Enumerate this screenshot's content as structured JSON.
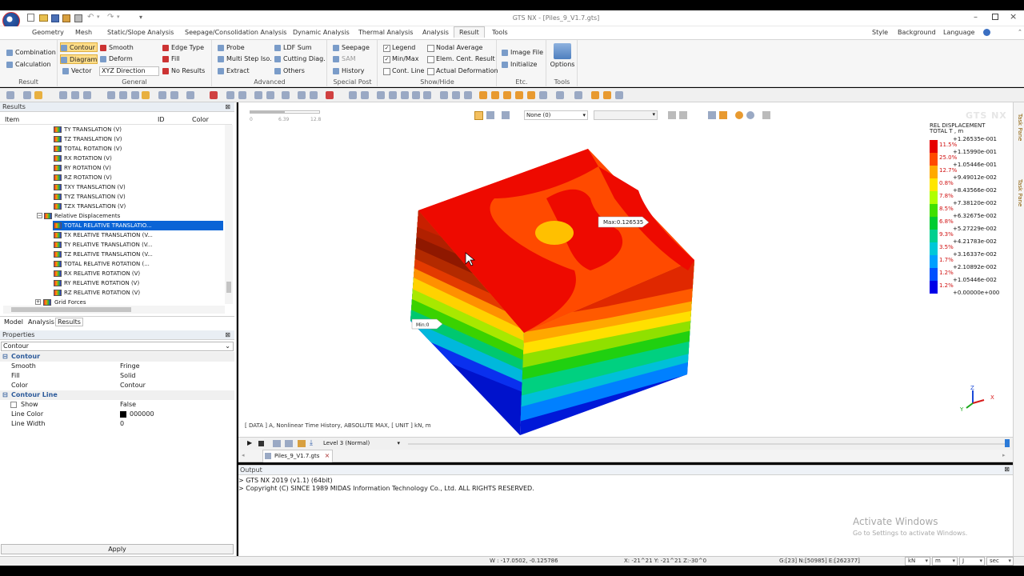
{
  "window": {
    "title": "GTS NX - [Piles_9_V1.7.gts]"
  },
  "menu": {
    "tabs": [
      "Geometry",
      "Mesh",
      "Static/Slope Analysis",
      "Seepage/Consolidation Analysis",
      "Dynamic Analysis",
      "Thermal Analysis",
      "Analysis",
      "Result",
      "Tools"
    ],
    "active": "Result",
    "right": [
      "Style",
      "Background",
      "Language"
    ]
  },
  "ribbon": {
    "result": {
      "items": [
        "Combination",
        "Calculation"
      ],
      "label": "Result"
    },
    "general": {
      "items": [
        "Contour",
        "Diagram",
        "Vector",
        "Smooth",
        "Deform",
        "XYZ Direction",
        "Edge Type",
        "Fill",
        "No Results"
      ],
      "label": "General"
    },
    "advanced": {
      "items": [
        "Probe",
        "Multi Step Iso.",
        "Extract",
        "LDF Sum",
        "Cutting Diag.",
        "Others"
      ],
      "label": "Advanced"
    },
    "special_post": {
      "items": [
        "Seepage",
        "SAM",
        "History"
      ],
      "label": "Special Post"
    },
    "show_hide": {
      "items": [
        "Legend",
        "Min/Max",
        "Cont. Line",
        "Nodal Average",
        "Elem. Cent. Result",
        "Actual Deformation"
      ],
      "label": "Show/Hide"
    },
    "etc": {
      "items": [
        "Image File",
        "Initialize"
      ],
      "label": "Etc."
    },
    "tools": {
      "items": [
        "Options"
      ],
      "label": "Tools"
    }
  },
  "results_panel": {
    "title": "Results",
    "columns": [
      "Item",
      "ID",
      "Color"
    ],
    "tree": [
      "TY TRANSLATION (V)",
      "TZ TRANSLATION (V)",
      "TOTAL ROTATION (V)",
      "RX ROTATION (V)",
      "RY ROTATION (V)",
      "RZ ROTATION (V)",
      "TXY TRANSLATION (V)",
      "TYZ TRANSLATION (V)",
      "TZX TRANSLATION (V)",
      "Relative Displacements",
      "TOTAL RELATIVE TRANSLATIO...",
      "TX RELATIVE TRANSLATION (V...",
      "TY RELATIVE TRANSLATION (V...",
      "TZ RELATIVE TRANSLATION (V...",
      "TOTAL RELATIVE ROTATION (...",
      "RX RELATIVE ROTATION (V)",
      "RY RELATIVE ROTATION (V)",
      "RZ RELATIVE ROTATION (V)",
      "Grid Forces"
    ],
    "tabs": [
      "Model",
      "Analysis",
      "Results"
    ]
  },
  "properties": {
    "title": "Properties",
    "selector": "Contour",
    "sections": [
      {
        "name": "Contour",
        "rows": [
          [
            "Smooth",
            "Fringe"
          ],
          [
            "Fill",
            "Solid"
          ],
          [
            "Color",
            "Contour"
          ]
        ]
      },
      {
        "name": "Contour Line",
        "rows": [
          [
            "Show",
            "False"
          ],
          [
            "Line Color",
            "000000"
          ],
          [
            "Line Width",
            "0"
          ]
        ]
      }
    ],
    "apply_label": "Apply"
  },
  "viewport": {
    "scale_ticks": [
      "0",
      "6.39",
      "12.8"
    ],
    "view_select": "None (0)",
    "brand": "GTS NX",
    "legend_title": "REL DISPLACEMENT",
    "legend_sub": "TOTAL T , m",
    "legend_values": [
      "+1.26535e-001",
      "+1.15990e-001",
      "+1.05446e-001",
      "+9.49012e-002",
      "+8.43566e-002",
      "+7.38120e-002",
      "+6.32675e-002",
      "+5.27229e-002",
      "+4.21783e-002",
      "+3.16337e-002",
      "+2.10892e-002",
      "+1.05446e-002",
      "+0.00000e+000"
    ],
    "legend_pcts": [
      "11.5%",
      "25.0%",
      "12.7%",
      "0.8%",
      "7.8%",
      "8.5%",
      "6.8%",
      "9.3%",
      "3.5%",
      "1.7%",
      "1.2%",
      "1.2%"
    ],
    "legend_colors": [
      "#e60000",
      "#ff4a00",
      "#ffaa00",
      "#ffe600",
      "#b0ff00",
      "#40e000",
      "#00cc30",
      "#00d090",
      "#00c8d8",
      "#00a0ff",
      "#0050ff",
      "#0000e8"
    ],
    "max_label": "Max:0.126535",
    "min_label": "Min:0",
    "info": "[ DATA ] A, Nonlinear Time History, ABSOLUTE MAX, [ UNIT ] kN, m",
    "axis_x": "X",
    "axis_y": "Y",
    "axis_z": "Z"
  },
  "anim": {
    "level": "Level 3 (Normal)"
  },
  "doc_tab": "Piles_9_V1.7.gts",
  "output": {
    "title": "Output",
    "lines": [
      "> GTS NX 2019 (v1.1) (64bit)",
      "> Copyright (C) SINCE 1989 MIDAS Information Technology Co., Ltd. ALL RIGHTS RESERVED."
    ],
    "watermark1": "Activate Windows",
    "watermark2": "Go to Settings to activate Windows."
  },
  "taskpane": [
    "Task Pane",
    "Task Pane"
  ],
  "status": {
    "w": "W : -17.0502, -0.125786",
    "x": "X: -21^21 Y: -21^21 Z:-30^0",
    "g": "G:[23] N:[50985] E:[262377]",
    "units": [
      "kN",
      "m",
      "J",
      "sec"
    ]
  }
}
